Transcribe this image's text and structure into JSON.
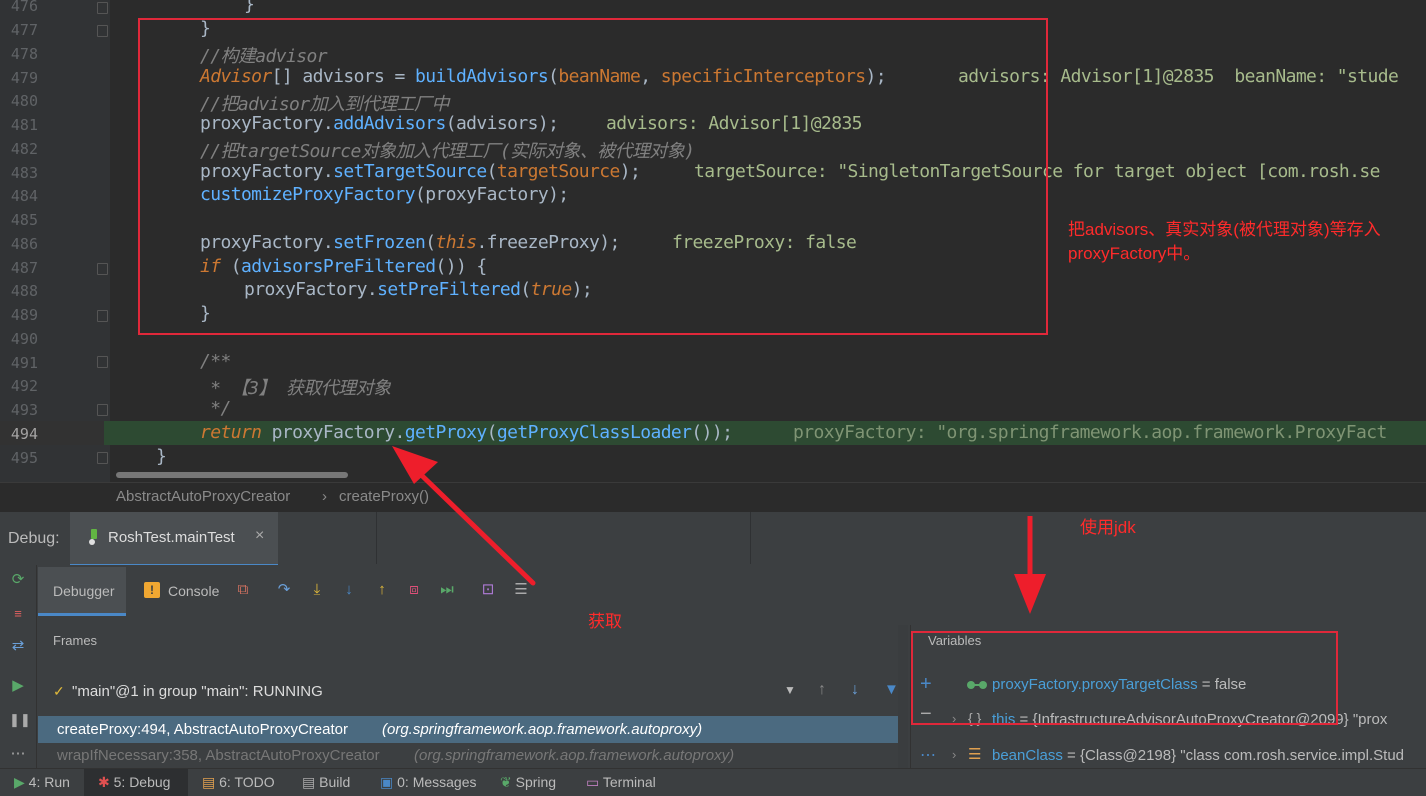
{
  "editor": {
    "line_numbers": [
      "476",
      "477",
      "478",
      "479",
      "480",
      "481",
      "482",
      "483",
      "484",
      "485",
      "486",
      "487",
      "488",
      "489",
      "490",
      "491",
      "492",
      "493",
      "494",
      "495"
    ],
    "lines": {
      "l476": "}",
      "l477": "}",
      "l478": "//构建advisor",
      "l479_a": "Advisor",
      "l479_b": "[] advisors = ",
      "l479_c": "buildAdvisors",
      "l479_d": "(",
      "l479_e": "beanName",
      "l479_f": ", ",
      "l479_g": "specificInterceptors",
      "l479_h": ");",
      "l479_dbg": "advisors: Advisor[1]@2835  beanName: \"stude",
      "l480": "//把advisor加入到代理工厂中",
      "l481_a": "proxyFactory.",
      "l481_b": "addAdvisors",
      "l481_c": "(advisors);",
      "l481_dbg": "advisors: Advisor[1]@2835",
      "l482": "//把targetSource对象加入代理工厂(实际对象、被代理对象)",
      "l483_a": "proxyFactory.",
      "l483_b": "setTargetSource",
      "l483_c": "(",
      "l483_d": "targetSource",
      "l483_e": ");",
      "l483_dbg": "targetSource: \"SingletonTargetSource for target object [com.rosh.se",
      "l484_a": "customizeProxyFactory",
      "l484_b": "(proxyFactory);",
      "l486_a": "proxyFactory.",
      "l486_b": "setFrozen",
      "l486_c": "(",
      "l486_d": "this",
      "l486_e": ".freezeProxy);",
      "l486_dbg": "freezeProxy: false",
      "l487_a": "if",
      "l487_b": " (",
      "l487_c": "advisorsPreFiltered",
      "l487_d": "()) {",
      "l488_a": "proxyFactory.",
      "l488_b": "setPreFiltered",
      "l488_c": "(",
      "l488_d": "true",
      "l488_e": ");",
      "l489": "}",
      "l491": "/**",
      "l492": " * 【3】 获取代理对象",
      "l493": " */",
      "l494_a": "return",
      "l494_b": " proxyFactory.",
      "l494_c": "getProxy",
      "l494_d": "(",
      "l494_e": "getProxyClassLoader",
      "l494_f": "());",
      "l494_dbg": "proxyFactory: \"org.springframework.aop.framework.ProxyFact",
      "l495": "}"
    }
  },
  "annotations": {
    "box_note_line1": "把advisors、真实对象(被代理对象)等存入",
    "box_note_line2": "proxyFactory中。",
    "get_label": "获取",
    "jdk_label": "使用jdk"
  },
  "breadcrumb": {
    "class_name": "AbstractAutoProxyCreator",
    "separator": "›",
    "method": "createProxy()"
  },
  "debug": {
    "title": "Debug:",
    "session_tab": "RoshTest.mainTest",
    "tab_debugger": "Debugger",
    "tab_console": "Console",
    "frames_label": "Frames",
    "variables_label": "Variables",
    "thread": "\"main\"@1 in group \"main\": RUNNING",
    "frames": [
      {
        "method": "createProxy:494, AbstractAutoProxyCreator",
        "pkg": "(org.springframework.aop.framework.autoproxy)"
      },
      {
        "method": "wrapIfNecessary:358, AbstractAutoProxyCreator",
        "pkg": "(org.springframework.aop.framework.autoproxy)"
      }
    ],
    "variables": [
      {
        "name": "proxyFactory.proxyTargetClass",
        "value": " = false"
      },
      {
        "name": "this",
        "value": " = {InfrastructureAdvisorAutoProxyCreator@2099} \"prox"
      },
      {
        "name": "beanClass",
        "value": " = {Class@2198} \"class com.rosh.service.impl.Stud"
      }
    ]
  },
  "statusbar": {
    "run": "4: Run",
    "debug": "5: Debug",
    "todo": "6: TODO",
    "build": "Build",
    "messages": "0: Messages",
    "spring": "Spring",
    "terminal": "Terminal"
  },
  "colors": {
    "accent_red": "#e0283a",
    "keyword": "#cc7832",
    "method": "#5fb1ff",
    "current_line": "#2d4a32"
  }
}
